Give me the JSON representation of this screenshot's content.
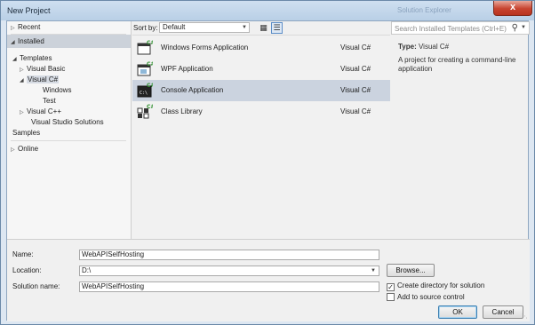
{
  "window": {
    "title": "New Project",
    "ghost_title": "Solution Explorer",
    "close_glyph": "x"
  },
  "tree": {
    "recent": "Recent",
    "installed": "Installed",
    "templates": "Templates",
    "visual_basic": "Visual Basic",
    "visual_csharp": "Visual C#",
    "windows": "Windows",
    "test": "Test",
    "visual_cpp": "Visual C++",
    "vs_solutions": "Visual Studio Solutions",
    "samples": "Samples",
    "online": "Online"
  },
  "sort": {
    "label": "Sort by:",
    "selected": "Default"
  },
  "search": {
    "placeholder": "Search Installed Templates (Ctrl+E)"
  },
  "templates": [
    {
      "name": "Windows Forms Application",
      "language": "Visual C#",
      "icon": "winforms-icon"
    },
    {
      "name": "WPF Application",
      "language": "Visual C#",
      "icon": "wpf-icon"
    },
    {
      "name": "Console Application",
      "language": "Visual C#",
      "icon": "console-icon"
    },
    {
      "name": "Class Library",
      "language": "Visual C#",
      "icon": "class-library-icon"
    }
  ],
  "detail": {
    "type_label": "Type:",
    "type_value": "Visual C#",
    "description": "A project for creating a command-line application"
  },
  "form": {
    "name_label": "Name:",
    "name_value": "WebAPISelfHosting",
    "location_label": "Location:",
    "location_value": "D:\\",
    "solution_label": "Solution name:",
    "solution_value": "WebAPISelfHosting",
    "browse": "Browse...",
    "create_dir": "Create directory for solution",
    "create_dir_checked": true,
    "source_control": "Add to source control",
    "source_control_checked": false,
    "ok": "OK",
    "cancel": "Cancel"
  },
  "colors": {
    "selection": "#cbd3df",
    "title_bar": "#c4d7ec",
    "close_button": "#c7432f"
  }
}
